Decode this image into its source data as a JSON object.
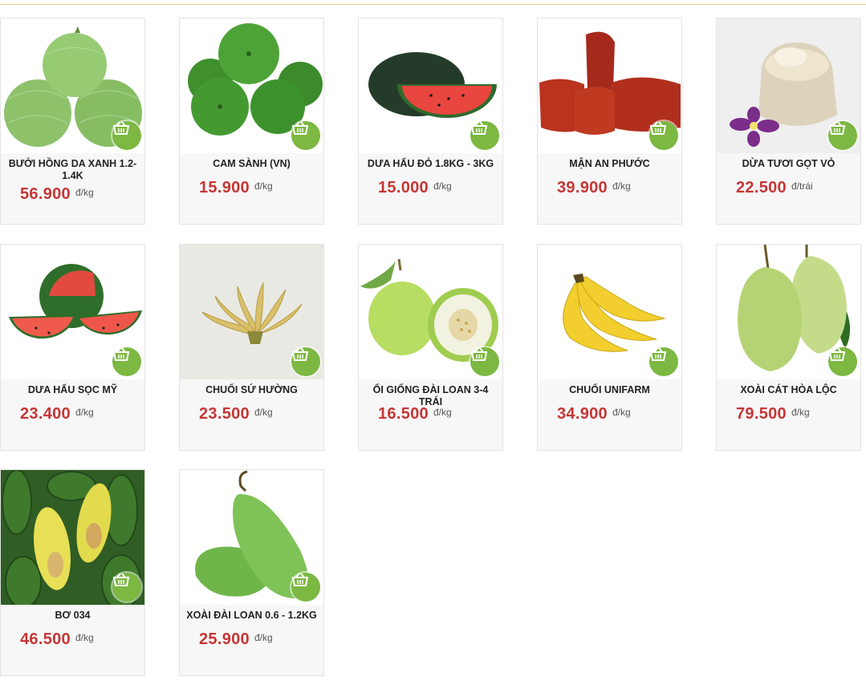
{
  "currency_unit_note": "",
  "products": [
    {
      "name": "BƯỞI HỒNG DA XANH 1.2-1.4K",
      "price": "56.900",
      "unit": "đ/kg",
      "icon": "pomelo-image"
    },
    {
      "name": "CAM SÀNH (VN)",
      "price": "15.900",
      "unit": "đ/kg",
      "icon": "orange-image"
    },
    {
      "name": "DƯA HẤU ĐỎ 1.8KG - 3KG",
      "price": "15.000",
      "unit": "đ/kg",
      "icon": "watermelon-image"
    },
    {
      "name": "MẬN AN PHƯỚC",
      "price": "39.900",
      "unit": "đ/kg",
      "icon": "rose-apple-image"
    },
    {
      "name": "DỪA TƯƠI GỌT VỎ",
      "price": "22.500",
      "unit": "đ/trái",
      "icon": "coconut-image"
    },
    {
      "name": "DƯA HẤU SỌC MỸ",
      "price": "23.400",
      "unit": "đ/kg",
      "icon": "striped-watermelon-image"
    },
    {
      "name": "CHUỐI SỨ HƯỜNG",
      "price": "23.500",
      "unit": "đ/kg",
      "icon": "banana-bunch-image"
    },
    {
      "name": "ỔI GIỐNG ĐÀI LOAN 3-4 TRÁI",
      "price": "16.500",
      "unit": "đ/kg",
      "icon": "guava-image"
    },
    {
      "name": "CHUỐI UNIFARM",
      "price": "34.900",
      "unit": "đ/kg",
      "icon": "banana-image"
    },
    {
      "name": "XOÀI CÁT HÒA LỘC",
      "price": "79.500",
      "unit": "đ/kg",
      "icon": "mango-image"
    },
    {
      "name": "BƠ 034",
      "price": "46.500",
      "unit": "đ/kg",
      "icon": "avocado-image"
    },
    {
      "name": "XOÀI ĐÀI LOAN 0.6 - 1.2KG",
      "price": "25.900",
      "unit": "đ/kg",
      "icon": "green-mango-image"
    }
  ],
  "colors": {
    "price": "#c73636",
    "cart_button": "#7cb842",
    "card_bg": "#f7f7f7",
    "top_rule": "#e9c98f"
  }
}
